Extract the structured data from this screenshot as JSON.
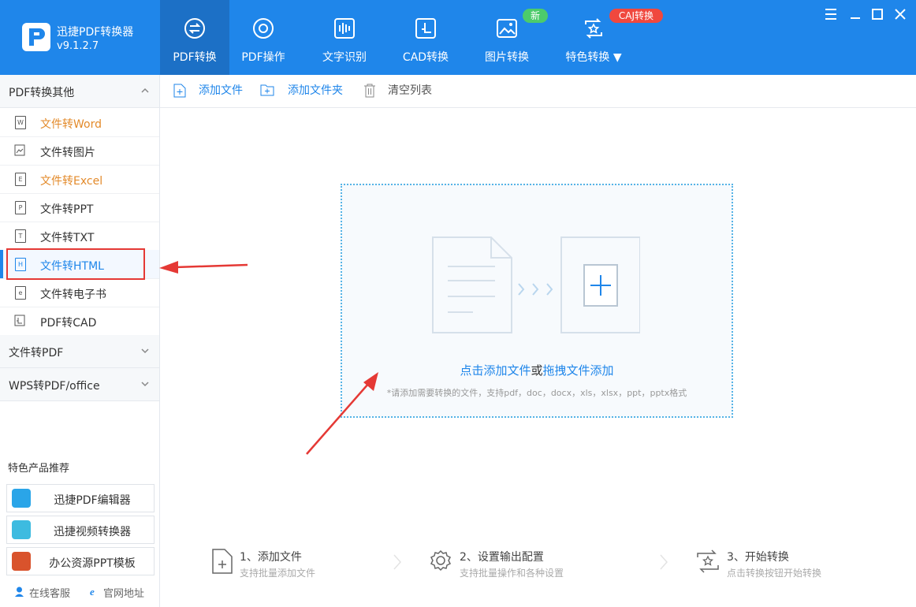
{
  "app": {
    "name": "迅捷PDF转换器",
    "version": "v9.1.2.7"
  },
  "nav": {
    "tabs": [
      {
        "label": "PDF转换"
      },
      {
        "label": "PDF操作"
      },
      {
        "label": "文字识别"
      },
      {
        "label": "CAD转换"
      },
      {
        "label": "图片转换"
      },
      {
        "label": "特色转换 ▼"
      }
    ],
    "badge_new": "新",
    "badge_caj": "CAJ转换"
  },
  "sidebar": {
    "groups": [
      {
        "title": "PDF转换其他"
      },
      {
        "title": "文件转PDF"
      },
      {
        "title": "WPS转PDF/office"
      }
    ],
    "items": [
      {
        "label": "文件转Word",
        "icon": "W"
      },
      {
        "label": "文件转图片",
        "icon": "img"
      },
      {
        "label": "文件转Excel",
        "icon": "E"
      },
      {
        "label": "文件转PPT",
        "icon": "P"
      },
      {
        "label": "文件转TXT",
        "icon": "T"
      },
      {
        "label": "文件转HTML",
        "icon": "H"
      },
      {
        "label": "文件转电子书",
        "icon": "e"
      },
      {
        "label": "PDF转CAD",
        "icon": "cad"
      }
    ],
    "recommend_title": "特色产品推荐",
    "products": [
      {
        "label": "迅捷PDF编辑器"
      },
      {
        "label": "迅捷视频转换器"
      },
      {
        "label": "办公资源PPT模板"
      }
    ],
    "footer": {
      "service": "在线客服",
      "website": "官网地址"
    }
  },
  "toolbar": {
    "add_file": "添加文件",
    "add_folder": "添加文件夹",
    "clear": "清空列表"
  },
  "drop": {
    "click_text": "点击添加文件",
    "or": "或",
    "drag_text": "拖拽文件添加",
    "hint": "*请添加需要转换的文件，支持pdf，doc，docx，xls，xlsx，ppt，pptx格式"
  },
  "steps": [
    {
      "title": "1、添加文件",
      "desc": "支持批量添加文件"
    },
    {
      "title": "2、设置输出配置",
      "desc": "支持批量操作和各种设置"
    },
    {
      "title": "3、开始转换",
      "desc": "点击转换按钮开始转换"
    }
  ],
  "colors": {
    "brand": "#1f86ea",
    "nav_active": "#1c70c6",
    "accent_orange": "#e38a2a",
    "annotation_red": "#e53935"
  }
}
